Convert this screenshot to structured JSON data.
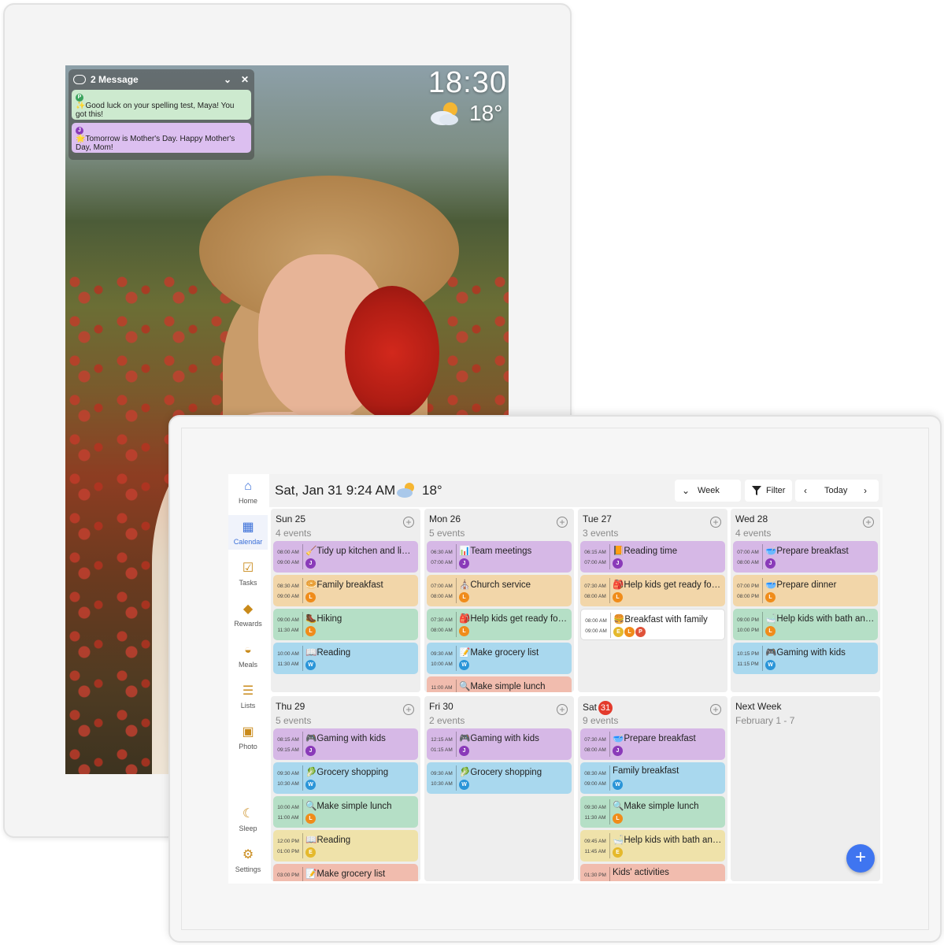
{
  "photo_frame": {
    "messages_header": "2 Message",
    "messages": [
      {
        "sender": "P",
        "sender_color": "#3aa35c",
        "emoji": "✨",
        "text": "Good luck on your spelling test, Maya! You got this!",
        "bg": "green"
      },
      {
        "sender": "J",
        "sender_color": "#8a3ab9",
        "emoji": "🌟",
        "text": "Tomorrow is Mother's Day. Happy Mother's Day, Mom!",
        "bg": "purple"
      }
    ],
    "clock": "18:30",
    "temperature": "18°",
    "weather_icon": "partly-cloudy-icon"
  },
  "calendar": {
    "header": {
      "datetime": "Sat, Jan 31 9:24 AM",
      "temperature": "18°",
      "weather_icon": "partly-cloudy-icon",
      "view_label": "Week",
      "filter_label": "Filter",
      "today_label": "Today"
    },
    "sidebar": [
      {
        "label": "Home",
        "icon": "home-icon",
        "glyph": "⌂"
      },
      {
        "label": "Calendar",
        "icon": "calendar-icon",
        "glyph": "▦"
      },
      {
        "label": "Tasks",
        "icon": "clipboard-check-icon",
        "glyph": "☑"
      },
      {
        "label": "Rewards",
        "icon": "diamond-icon",
        "glyph": "◆"
      },
      {
        "label": "Meals",
        "icon": "cloche-icon",
        "glyph": "◒"
      },
      {
        "label": "Lists",
        "icon": "list-icon",
        "glyph": "☰"
      },
      {
        "label": "Photo",
        "icon": "photo-icon",
        "glyph": "▣"
      },
      {
        "label": "Sleep",
        "icon": "moon-icon",
        "glyph": "☾"
      },
      {
        "label": "Settings",
        "icon": "gear-icon",
        "glyph": "⚙"
      }
    ],
    "avatar_colors": {
      "J": "#8a3ab9",
      "L": "#f08c1a",
      "W": "#2a95d8",
      "E": "#e5b92c",
      "P": "#e0533a"
    },
    "days": [
      {
        "name": "Sun 25",
        "count": "4 events",
        "events": [
          {
            "start": "08:00 AM",
            "end": "09:00 AM",
            "icon": "🧹",
            "title": "Tidy up kitchen and livi...",
            "color": "purple",
            "avatars": [
              "J"
            ]
          },
          {
            "start": "08:30 AM",
            "end": "09:00 AM",
            "icon": "🥯",
            "title": "Family breakfast",
            "color": "orange",
            "avatars": [
              "L"
            ]
          },
          {
            "start": "09:00 AM",
            "end": "11:30 AM",
            "icon": "🥾",
            "title": "Hiking",
            "color": "green",
            "avatars": [
              "L"
            ]
          },
          {
            "start": "10:00 AM",
            "end": "11:30 AM",
            "icon": "📖",
            "title": "Reading",
            "color": "blue",
            "avatars": [
              "W"
            ]
          }
        ]
      },
      {
        "name": "Mon 26",
        "count": "5 events",
        "events": [
          {
            "start": "06:30 AM",
            "end": "07:00 AM",
            "icon": "📊",
            "title": "Team meetings",
            "color": "purple",
            "avatars": [
              "J"
            ]
          },
          {
            "start": "07:00 AM",
            "end": "08:00 AM",
            "icon": "⛪",
            "title": "Church service",
            "color": "orange",
            "avatars": [
              "L"
            ]
          },
          {
            "start": "07:30 AM",
            "end": "08:00 AM",
            "icon": "🎒",
            "title": "Help kids get ready for ...",
            "color": "green",
            "avatars": [
              "L"
            ]
          },
          {
            "start": "09:30 AM",
            "end": "10:00 AM",
            "icon": "📝",
            "title": "Make grocery list",
            "color": "blue",
            "avatars": [
              "W"
            ]
          },
          {
            "start": "11:00 AM",
            "end": "",
            "icon": "🔍",
            "title": "Make simple lunch",
            "color": "salmon",
            "avatars": []
          }
        ]
      },
      {
        "name": "Tue 27",
        "count": "3 events",
        "events": [
          {
            "start": "06:15 AM",
            "end": "07:00 AM",
            "icon": "📙",
            "title": "Reading time",
            "color": "purple",
            "avatars": [
              "J"
            ]
          },
          {
            "start": "07:30 AM",
            "end": "08:00 AM",
            "icon": "🎒",
            "title": "Help kids get ready for ...",
            "color": "orange",
            "avatars": [
              "L"
            ]
          },
          {
            "start": "08:00 AM",
            "end": "09:00 AM",
            "icon": "🍔",
            "title": "Breakfast with family",
            "color": "white",
            "avatars": [
              "E",
              "L",
              "P"
            ]
          }
        ]
      },
      {
        "name": "Wed 28",
        "count": "4 events",
        "events": [
          {
            "start": "07:00 AM",
            "end": "08:00 AM",
            "icon": "🥣",
            "title": "Prepare breakfast",
            "color": "purple",
            "avatars": [
              "J"
            ]
          },
          {
            "start": "07:00 PM",
            "end": "08:00 PM",
            "icon": "🥣",
            "title": "Prepare dinner",
            "color": "orange",
            "avatars": [
              "L"
            ]
          },
          {
            "start": "09:00 PM",
            "end": "10:00 PM",
            "icon": "🛁",
            "title": "Help kids with bath and ...",
            "color": "green",
            "avatars": [
              "L"
            ]
          },
          {
            "start": "10:15 PM",
            "end": "11:15 PM",
            "icon": "🎮",
            "title": "Gaming with kids",
            "color": "blue",
            "avatars": [
              "W"
            ]
          }
        ]
      },
      {
        "name": "Thu 29",
        "count": "5 events",
        "events": [
          {
            "start": "08:15 AM",
            "end": "09:15 AM",
            "icon": "🎮",
            "title": "Gaming with kids",
            "color": "purple",
            "avatars": [
              "J"
            ]
          },
          {
            "start": "09:30 AM",
            "end": "10:30 AM",
            "icon": "🥬",
            "title": "Grocery shopping",
            "color": "blue",
            "avatars": [
              "W"
            ]
          },
          {
            "start": "10:00 AM",
            "end": "11:00 AM",
            "icon": "🔍",
            "title": "Make simple lunch",
            "color": "green",
            "avatars": [
              "L"
            ]
          },
          {
            "start": "12:00 PM",
            "end": "01:00 PM",
            "icon": "📖",
            "title": "Reading",
            "color": "yellow",
            "avatars": [
              "E"
            ]
          },
          {
            "start": "03:00 PM",
            "end": "",
            "icon": "📝",
            "title": "Make grocery list",
            "color": "salmon",
            "avatars": []
          }
        ]
      },
      {
        "name": "Fri 30",
        "count": "2 events",
        "events": [
          {
            "start": "12:15 AM",
            "end": "01:15 AM",
            "icon": "🎮",
            "title": "Gaming with kids",
            "color": "purple",
            "avatars": [
              "J"
            ]
          },
          {
            "start": "09:30 AM",
            "end": "10:30 AM",
            "icon": "🥬",
            "title": "Grocery shopping",
            "color": "blue",
            "avatars": [
              "W"
            ]
          }
        ]
      },
      {
        "name": "Sat",
        "name_num": "31",
        "count": "9 events",
        "events": [
          {
            "start": "07:30 AM",
            "end": "08:00 AM",
            "icon": "🥣",
            "title": "Prepare breakfast",
            "color": "purple",
            "avatars": [
              "J"
            ]
          },
          {
            "start": "08:30 AM",
            "end": "09:00 AM",
            "icon": "",
            "title": "Family breakfast",
            "color": "blue",
            "avatars": [
              "W"
            ]
          },
          {
            "start": "09:30 AM",
            "end": "11:30 AM",
            "icon": "🔍",
            "title": "Make simple lunch",
            "color": "green",
            "avatars": [
              "L"
            ]
          },
          {
            "start": "09:45 AM",
            "end": "11:45 AM",
            "icon": "🛁",
            "title": "Help kids with bath and ...",
            "color": "yellow",
            "avatars": [
              "E"
            ]
          },
          {
            "start": "01:30 PM",
            "end": "",
            "icon": "",
            "title": "Kids' activities",
            "color": "salmon",
            "avatars": []
          }
        ]
      }
    ],
    "next_week": {
      "title": "Next Week",
      "range": "February 1 - 7"
    }
  }
}
